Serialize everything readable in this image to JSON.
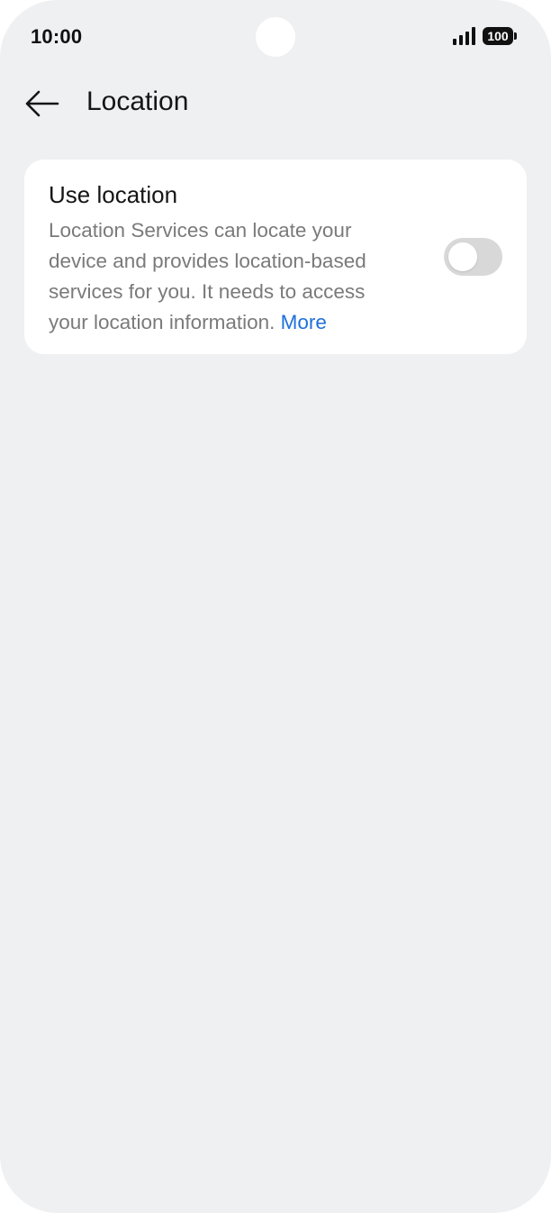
{
  "status_bar": {
    "time": "10:00",
    "battery": "100"
  },
  "header": {
    "title": "Location",
    "back_icon": "arrow-left-icon"
  },
  "location_card": {
    "title": "Use location",
    "description": "Location Services can locate your device and provides location-based services for you. It needs to access your location information.",
    "more_link": "More",
    "toggle_on": false
  },
  "colors": {
    "background": "#eff0f2",
    "card": "#ffffff",
    "link": "#1f6fdc",
    "toggle_off": "#d8d8d8"
  }
}
